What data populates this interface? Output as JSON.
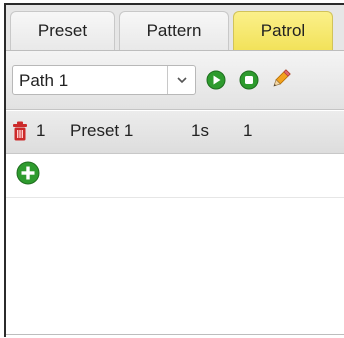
{
  "tabs": [
    {
      "label": "Preset",
      "active": false
    },
    {
      "label": "Pattern",
      "active": false
    },
    {
      "label": "Patrol",
      "active": true
    }
  ],
  "toolbar": {
    "path_select_value": "Path 1",
    "buttons": [
      {
        "icon": "play-icon",
        "color": "#2e9b2e"
      },
      {
        "icon": "stop-icon",
        "color": "#2e9b2e"
      },
      {
        "icon": "pencil-icon",
        "color": "#f0a020"
      }
    ]
  },
  "patrol_rows": [
    {
      "index": "1",
      "preset": "Preset 1",
      "time": "1s",
      "speed": "1"
    }
  ],
  "colors": {
    "active_tab": "#f2e25a",
    "accent_green": "#2e9b2e",
    "delete_red": "#cc2a2a"
  }
}
